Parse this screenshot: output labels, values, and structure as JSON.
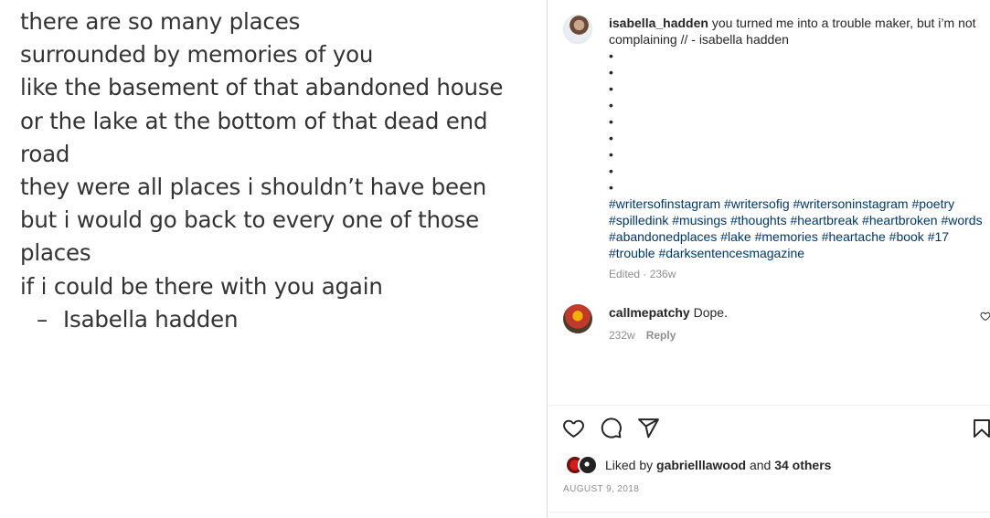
{
  "poem": {
    "lines": [
      "there are so many places",
      "surrounded by memories of you",
      "like the basement of that abandoned house",
      "or the lake at the bottom of that dead end",
      "road",
      "they were all places i shouldn’t have been",
      "but i would go back to every one of those",
      "places",
      "if i could be there with you again"
    ],
    "signature_dash": "–",
    "signature_name": "Isabella hadden"
  },
  "post": {
    "author": "isabella_hadden",
    "caption_text": "you turned me into a trouble maker, but i’m not complaining // - isabella hadden",
    "bullets": [
      "•",
      "•",
      "•",
      "•",
      "•",
      "•",
      "•",
      "•",
      "•"
    ],
    "hashtags": "#writersofinstagram #writersofig #writersoninstagram #poetry #spilledink #musings #thoughts #heartbreak #heartbroken #words #abandonedplaces #lake #memories #heartache #book #17 #trouble #darksentencesmagazine",
    "caption_meta": "Edited · 236w",
    "comment": {
      "username": "callmepatchy",
      "text": "Dope.",
      "age": "232w",
      "reply_label": "Reply"
    },
    "likes": {
      "prefix": "Liked by",
      "user": "gabrielllawood",
      "middle": "and",
      "others": "34 others"
    },
    "date": "August 9, 2018"
  },
  "icons": {
    "like": "heart-icon",
    "comment": "comment-icon",
    "share": "share-icon",
    "save": "bookmark-icon",
    "comment_like": "small-heart-icon"
  },
  "colors": {
    "text": "#262626",
    "hashtag": "#00376b",
    "muted": "#8e8e8e"
  }
}
